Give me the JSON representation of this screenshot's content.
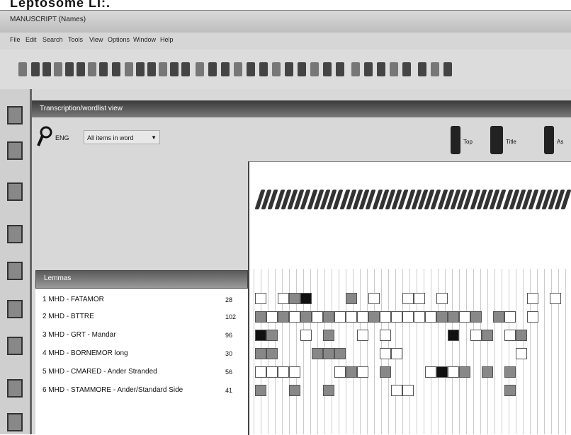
{
  "top_strip_text": "Leptosome LI:.",
  "window_title": "MANUSCRIPT (Names)",
  "menu": [
    "File",
    "Edit",
    "Search",
    "Tools",
    "View",
    "Options",
    "Window",
    "Help"
  ],
  "panel_title": "Transcription/wordlist view",
  "search": {
    "label": "ENG",
    "dropdown_value": "All items in word"
  },
  "right_tools": [
    {
      "label": "Top"
    },
    {
      "label": "Title"
    },
    {
      "label": "As"
    }
  ],
  "tree": {
    "header": "Lemmas",
    "rows": [
      {
        "label": "1 MHD - FATAMOR",
        "value": "28"
      },
      {
        "label": "2 MHD - BTTRE",
        "value": "102"
      },
      {
        "label": "3 MHD - GRT - Mandar",
        "value": "96"
      },
      {
        "label": "4 MHD - BORNEMOR long",
        "value": "30"
      },
      {
        "label": "5 MHD - CMARED - Ander Stranded",
        "value": "56"
      },
      {
        "label": "6 MHD - STAMMORE - Ander/Standard Side",
        "value": "41"
      }
    ]
  },
  "colors": {
    "panel_title": "#3a3a3a",
    "accent": "#555555"
  }
}
